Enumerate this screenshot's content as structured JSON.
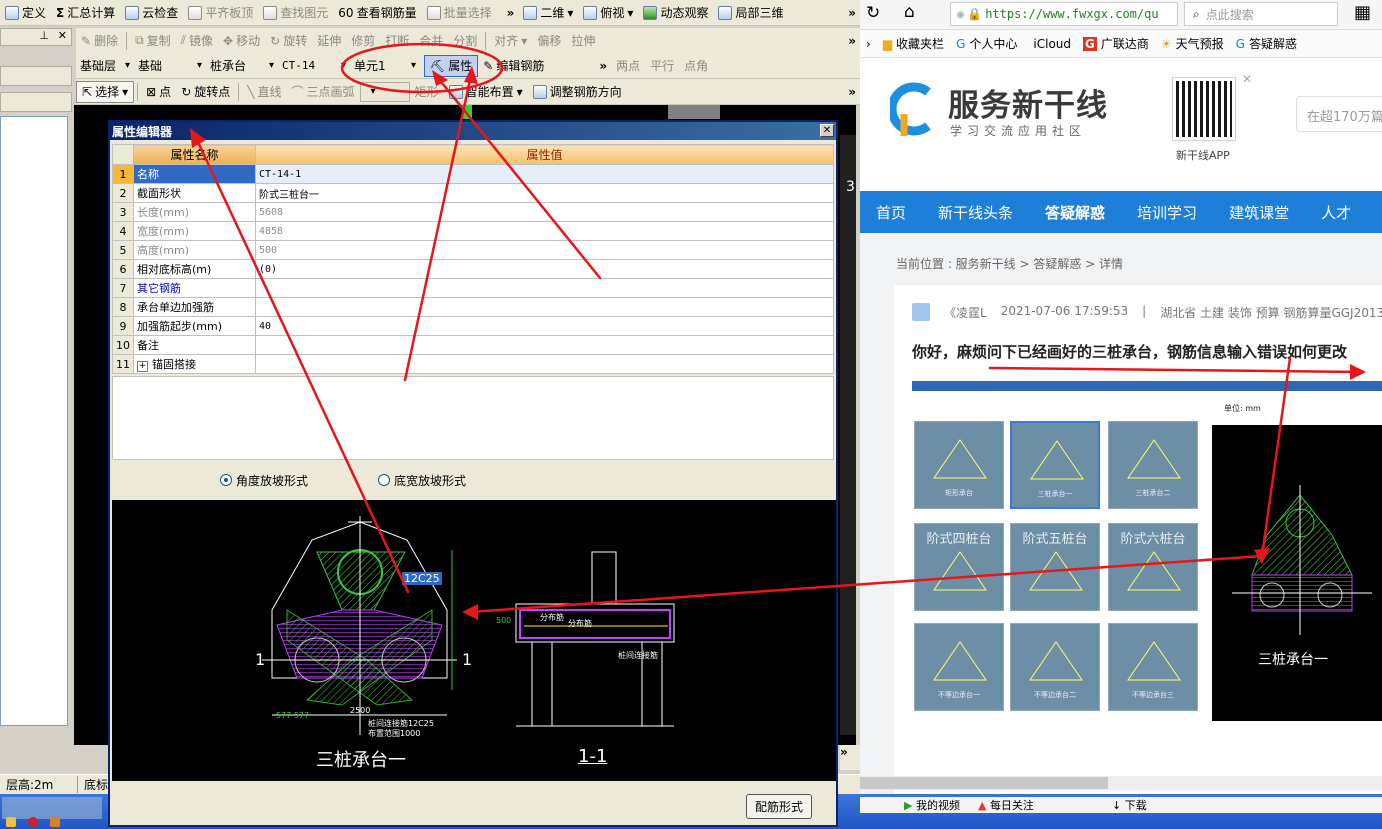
{
  "toolbar1": {
    "items": [
      "定义",
      "汇总计算",
      "云检查",
      "平齐板顶",
      "查找图元",
      "查看钢筋量",
      "批量选择"
    ],
    "view_mode": "二维",
    "view_dir": "俯视",
    "orbit": "动态观察",
    "local3d": "局部三维"
  },
  "toolbar2": {
    "items": [
      "删除",
      "复制",
      "镜像",
      "移动",
      "旋转",
      "延伸",
      "修剪",
      "打断",
      "合并",
      "分割",
      "对齐",
      "偏移",
      "拉伸"
    ]
  },
  "toolbar3": {
    "floor": "基础层",
    "category": "基础",
    "type": "桩承台",
    "component": "CT-14",
    "unit": "单元1",
    "property_btn": "属性",
    "edit_rebar_btn": "编辑钢筋",
    "snap": [
      "两点",
      "平行",
      "点角"
    ]
  },
  "toolbar4": {
    "select": "选择",
    "point": "点",
    "rotate_point": "旋转点",
    "line": "直线",
    "arc": "三点画弧",
    "rect": "矩形",
    "smart": "智能布置",
    "adjust": "调整钢筋方向"
  },
  "status": {
    "floor_height": "层高:2m",
    "bottom": "底标"
  },
  "dialog": {
    "title": "属性编辑器",
    "col_name": "属性名称",
    "col_value": "属性值",
    "rows": [
      {
        "n": "1",
        "name": "名称",
        "value": "CT-14-1"
      },
      {
        "n": "2",
        "name": "截面形状",
        "value": "阶式三桩台一"
      },
      {
        "n": "3",
        "name": "长度(mm)",
        "value": "5608"
      },
      {
        "n": "4",
        "name": "宽度(mm)",
        "value": "4858"
      },
      {
        "n": "5",
        "name": "高度(mm)",
        "value": "500"
      },
      {
        "n": "6",
        "name": "相对底标高(m)",
        "value": "(0)"
      },
      {
        "n": "7",
        "name": "其它钢筋",
        "value": ""
      },
      {
        "n": "8",
        "name": "承台单边加强筋",
        "value": ""
      },
      {
        "n": "9",
        "name": "加强筋起步(mm)",
        "value": "40"
      },
      {
        "n": "10",
        "name": "备注",
        "value": ""
      },
      {
        "n": "11",
        "name": "锚固搭接",
        "value": ""
      }
    ],
    "radio1": "角度放坡形式",
    "radio2": "底宽放坡形式",
    "drawing_title": "三桩承台一",
    "section_title": "1-1",
    "rebar_label": "12C25",
    "lbl_dim_a": "577  577",
    "lbl_a": "2500",
    "lbl_side": "1",
    "lbl_h": "500",
    "lbl_fen": "分布筋",
    "lbl_conn": "桩间连接筋",
    "lbl_conn2": "桩间连接筋12C25",
    "lbl_range": "布置范围1000",
    "btn_config": "配筋形式"
  },
  "browser": {
    "url": "https://www.fwxgx.com/qu",
    "search_placeholder": "点此搜索",
    "bookmarks": [
      "收藏夹栏",
      "个人中心",
      "iCloud",
      "广联达商",
      "天气预报",
      "答疑解惑"
    ],
    "site_name": "服务新干线",
    "site_slogan": "学习交流应用社区",
    "app_label": "新干线APP",
    "site_search": "在超170万篇",
    "nav": [
      "首页",
      "新干线头条",
      "答疑解惑",
      "培训学习",
      "建筑课堂",
      "人才"
    ],
    "breadcrumb": "当前位置 : 服务新干线 > 答疑解惑 > 详情",
    "author": "《凌霆L",
    "time": "2021-07-06 17:59:53",
    "meta": "湖北省  土建 装饰 预算 钢筋算量GGJ2013",
    "question": "你好，麻烦问下已经画好的三桩承台，钢筋信息输入错误如何更改",
    "thumbs": [
      "矩形承台",
      "三桩承台一",
      "三桩承台二",
      "阶式四桩台",
      "阶式五桩台",
      "阶式六桩台",
      "不等边承台一",
      "不等边承台二",
      "不等边承台三"
    ],
    "preview_unit": "单位: mm",
    "preview_title": "三桩承台一",
    "bottom": [
      "我的视频",
      "每日关注",
      "下载"
    ]
  },
  "colors": {
    "annotation": "#e8151b",
    "accent": "#1d7fd8",
    "cad_green": "#3ec43e",
    "cad_magenta": "#c040ff"
  }
}
